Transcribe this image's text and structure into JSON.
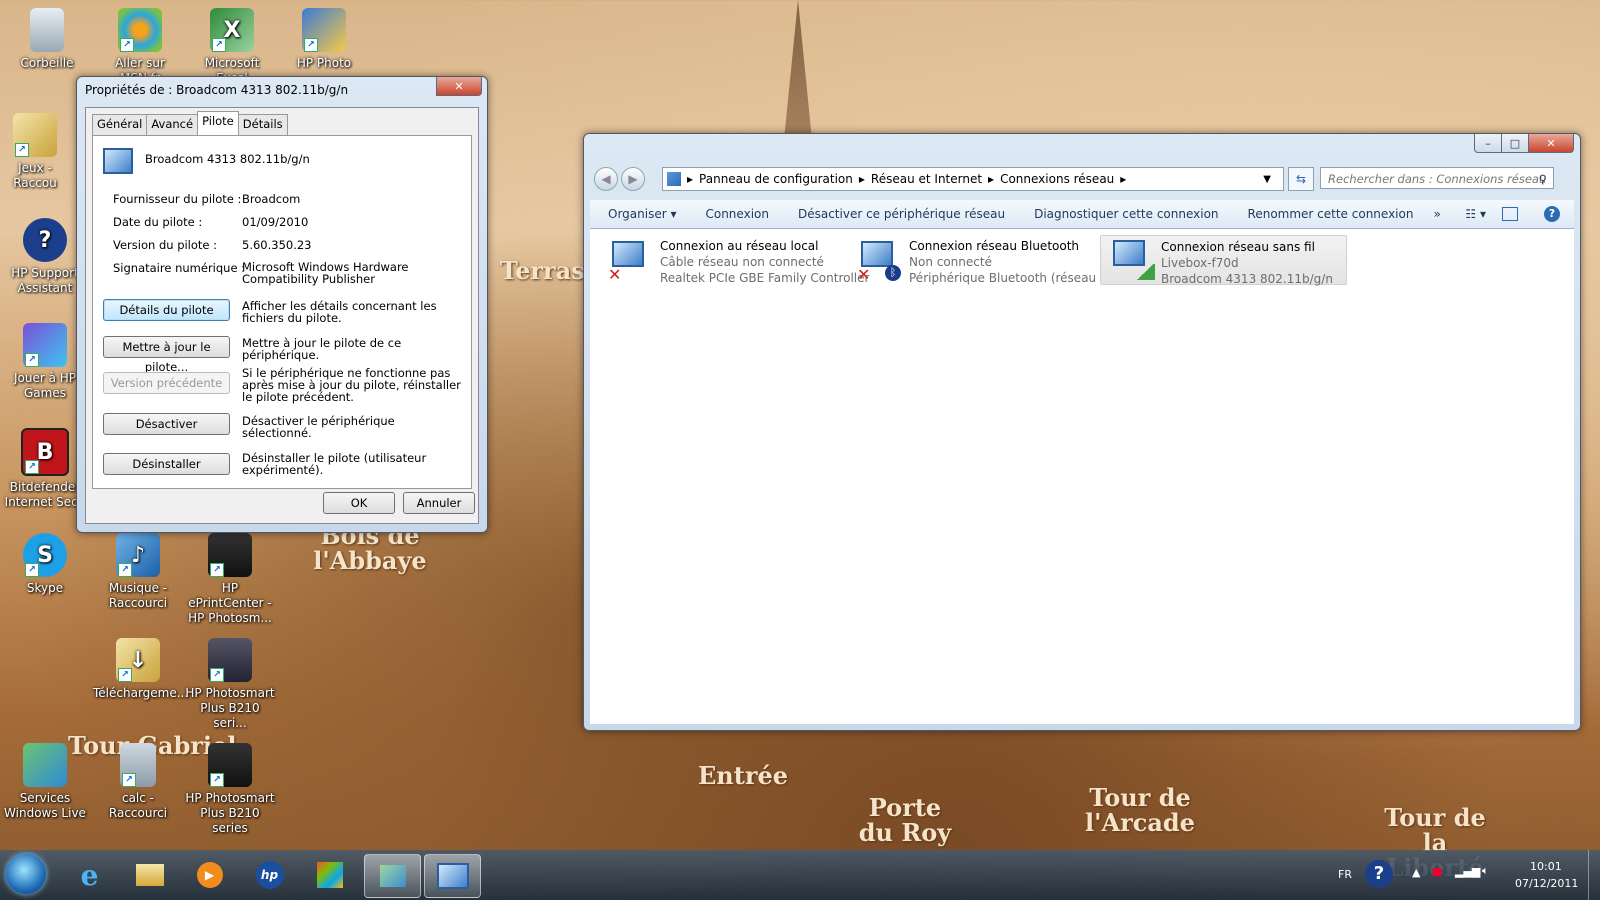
{
  "desktop": {
    "icons": [
      {
        "label": "Corbeille",
        "icon": "recycle-bin-icon"
      },
      {
        "label": "Aller sur MSN.fr",
        "icon": "msn-icon"
      },
      {
        "label": "Microsoft Excel",
        "icon": "excel-icon"
      },
      {
        "label": "HP Photo",
        "icon": "hp-photo-icon"
      },
      {
        "label": "Jeux - Raccou",
        "icon": "games-folder-icon"
      },
      {
        "label": "HP Support Assistant",
        "icon": "help-icon"
      },
      {
        "label": "Jouer à HP Games",
        "icon": "hp-games-icon"
      },
      {
        "label": "Bitdefender Internet Secu",
        "icon": "bitdefender-icon"
      },
      {
        "label": "Skype",
        "icon": "skype-icon"
      },
      {
        "label": "Musique - Raccourci",
        "icon": "music-icon"
      },
      {
        "label": "HP ePrintCenter - HP Photosm...",
        "icon": "printer-icon"
      },
      {
        "label": "Téléchargeme...",
        "icon": "download-folder-icon"
      },
      {
        "label": "HP Photosmart Plus B210 seri...",
        "icon": "scanner-icon"
      },
      {
        "label": "Services Windows Live",
        "icon": "windows-live-icon"
      },
      {
        "label": "calc - Raccourci",
        "icon": "calculator-icon"
      },
      {
        "label": "HP Photosmart Plus B210 series",
        "icon": "printer-icon"
      }
    ],
    "wallpaper_text": [
      "Terras",
      "Bois de l'Abbaye",
      "Tour Gabriel",
      "Entrée",
      "Porte du Roy",
      "Tour de l'Arcade",
      "Tour de la Liberté"
    ]
  },
  "dialog": {
    "title": "Propriétés de : Broadcom 4313 802.11b/g/n",
    "tabs": [
      "Général",
      "Avancé",
      "Pilote",
      "Détails"
    ],
    "device_name": "Broadcom 4313 802.11b/g/n",
    "fields": [
      {
        "label": "Fournisseur du pilote :",
        "value": "Broadcom"
      },
      {
        "label": "Date du pilote :",
        "value": "01/09/2010"
      },
      {
        "label": "Version du pilote :",
        "value": "5.60.350.23"
      },
      {
        "label": "Signataire numérique :",
        "value": "Microsoft Windows Hardware Compatibility Publisher"
      }
    ],
    "actions": [
      {
        "button": "Détails du pilote",
        "desc": "Afficher les détails concernant les fichiers du pilote."
      },
      {
        "button": "Mettre à jour le pilote...",
        "desc": "Mettre à jour le pilote de ce périphérique."
      },
      {
        "button": "Version précédente",
        "desc": "Si le périphérique ne fonctionne pas après mise à jour du pilote, réinstaller le pilote précédent."
      },
      {
        "button": "Désactiver",
        "desc": "Désactiver le périphérique sélectionné."
      },
      {
        "button": "Désinstaller",
        "desc": "Désinstaller le pilote (utilisateur expérimenté)."
      }
    ],
    "ok": "OK",
    "cancel": "Annuler"
  },
  "explorer": {
    "breadcrumb": [
      "Panneau de configuration",
      "Réseau et Internet",
      "Connexions réseau"
    ],
    "search_placeholder": "Rechercher dans : Connexions réseau",
    "commands": [
      "Organiser ▾",
      "Connexion",
      "Désactiver ce périphérique réseau",
      "Diagnostiquer cette connexion",
      "Renommer cette connexion",
      "»"
    ],
    "connections": [
      {
        "name": "Connexion au réseau local",
        "status": "Câble réseau non connecté",
        "device": "Realtek PCIe GBE Family Controller"
      },
      {
        "name": "Connexion réseau Bluetooth",
        "status": "Non connecté",
        "device": "Périphérique Bluetooth (réseau p..."
      },
      {
        "name": "Connexion réseau sans fil",
        "status": "Livebox-f70d",
        "device": "Broadcom 4313 802.11b/g/n"
      }
    ]
  },
  "taskbar": {
    "lang": "FR",
    "time": "10:01",
    "date": "07/12/2011"
  }
}
